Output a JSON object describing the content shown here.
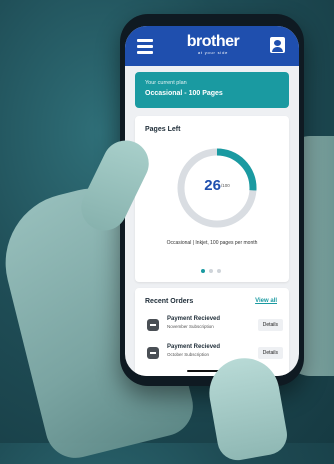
{
  "header": {
    "brand": "brother",
    "brand_tagline": "at your side"
  },
  "plan": {
    "caption": "Your current plan",
    "name": "Occasional - 100 Pages"
  },
  "pages_left": {
    "title": "Pages Left",
    "remaining": "26",
    "total": "/100",
    "fraction_remaining": 0.26,
    "description": "Occasional | Inkjet, 100 pages per month",
    "carousel_page": 1,
    "carousel_count": 3
  },
  "recent_orders": {
    "title": "Recent Orders",
    "view_all_label": "View all",
    "items": [
      {
        "title": "Payment Recieved",
        "subtitle": "November Subscription",
        "action": "Details"
      },
      {
        "title": "Payment Recieved",
        "subtitle": "October Subscription",
        "action": "Details"
      }
    ]
  },
  "colors": {
    "header_blue": "#1f4fae",
    "teal_accent": "#1a9aa1",
    "gauge_track": "#d9dde2"
  },
  "icons": [
    "menu-icon",
    "account-icon",
    "order-icon"
  ]
}
